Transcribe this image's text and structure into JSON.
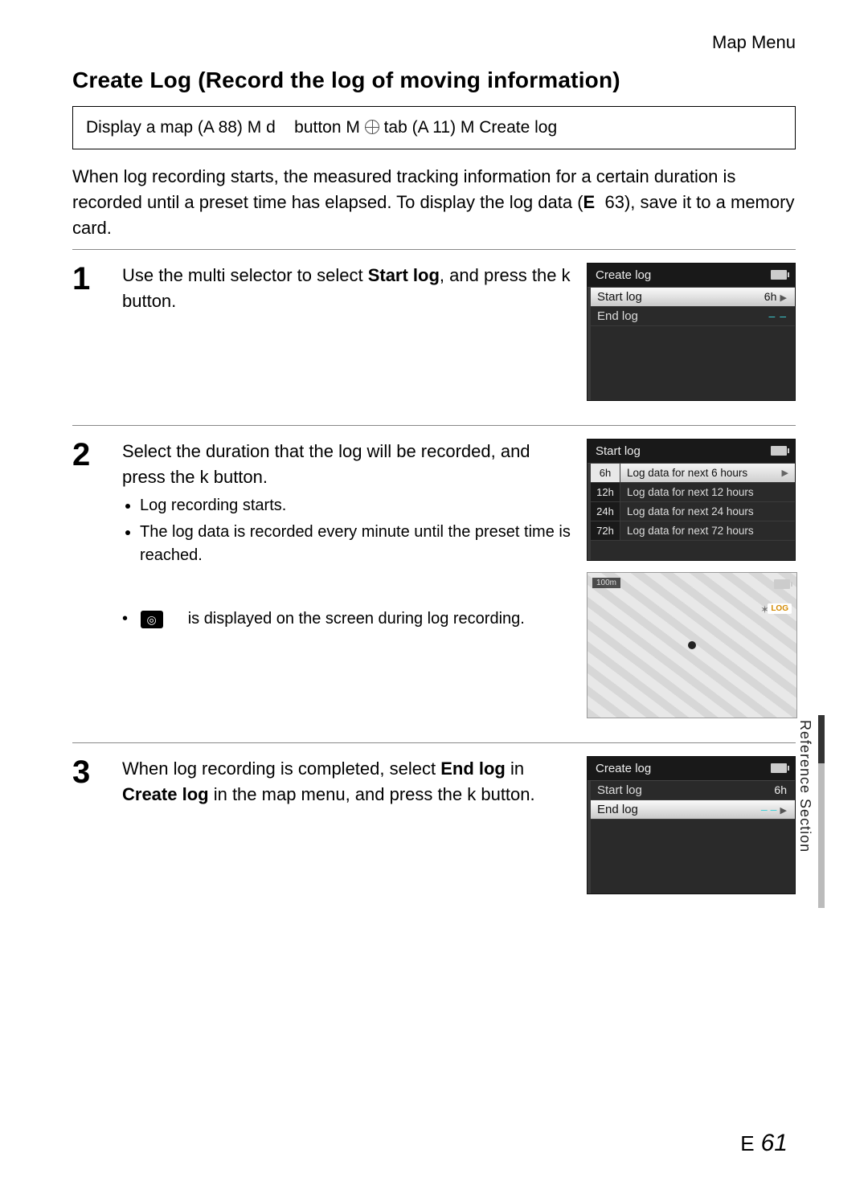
{
  "header": {
    "breadcrumb": "Map Menu"
  },
  "title": "Create Log (Record the log of moving information)",
  "navpath": {
    "p1": "Display a map (A  88)",
    "sep": "M",
    "p2": "d",
    "p3": "button",
    "p4": "tab (A  11)",
    "p5": "Create log"
  },
  "intro": {
    "line1": "When log recording starts, the measured tracking information for a certain duration is recorded until a preset time has elapsed. To display the log data (",
    "ref_icon": "E",
    "ref_num": "63",
    "line2": "), save it to a memory card."
  },
  "steps": {
    "s1": {
      "num": "1",
      "text_before": "Use the multi selector to select ",
      "text_bold": "Start log",
      "text_after": ", and press the ",
      "btn": "k",
      "text_end": " button.",
      "lcd": {
        "title": "Create log",
        "rows": [
          {
            "label": "Start log",
            "value": "6h",
            "selected": true,
            "arrow": true,
            "dash": false
          },
          {
            "label": "End log",
            "value": "– –",
            "selected": false,
            "arrow": false,
            "dash": true
          }
        ]
      }
    },
    "s2": {
      "num": "2",
      "heading_a": "Select the duration that the log will be recorded, and press the ",
      "btn": "k",
      "heading_b": " button.",
      "bullets": [
        "Log recording starts.",
        "The log data is recorded every minute until the preset time is reached."
      ],
      "indicator_text": "is displayed on the screen during log recording.",
      "log_glyph": "◎",
      "lcd": {
        "title": "Start log",
        "options": [
          {
            "tag": "6h",
            "label": "Log data for next 6 hours",
            "selected": true
          },
          {
            "tag": "12h",
            "label": "Log data for next 12 hours",
            "selected": false
          },
          {
            "tag": "24h",
            "label": "Log data for next 24 hours",
            "selected": false
          },
          {
            "tag": "72h",
            "label": "Log data for next 72 hours",
            "selected": false
          }
        ]
      },
      "map": {
        "scale": "100m",
        "log_badge": "LOG"
      }
    },
    "s3": {
      "num": "3",
      "t1": "When log recording is completed, select ",
      "b1": "End log",
      "t2": " in ",
      "b2": "Create log",
      "t3": " in the map menu, and press the ",
      "btn": "k",
      "t4": " button.",
      "lcd": {
        "title": "Create log",
        "rows": [
          {
            "label": "Start log",
            "value": "6h",
            "selected": false,
            "arrow": false,
            "dash": false
          },
          {
            "label": "End log",
            "value": "– –",
            "selected": true,
            "arrow": true,
            "dash": true
          }
        ]
      }
    }
  },
  "side_label": "Reference Section",
  "footer": {
    "prefix": "E",
    "page": "61"
  }
}
